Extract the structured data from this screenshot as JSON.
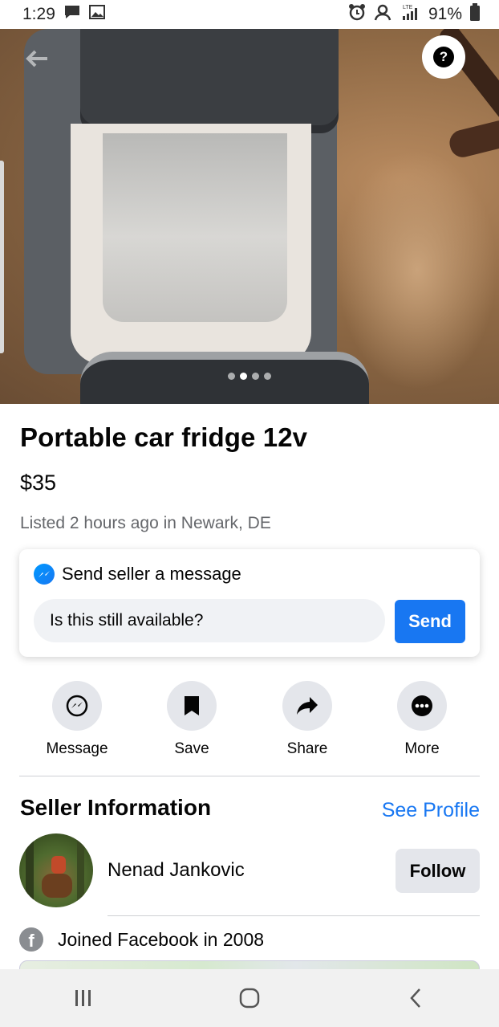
{
  "status_bar": {
    "time": "1:29",
    "battery": "91%",
    "icons": [
      "message-icon",
      "image-icon",
      "alarm-icon",
      "account-icon",
      "lte-signal-icon",
      "battery-icon"
    ]
  },
  "hero": {
    "image": "portable-car-fridge-photo",
    "slide_count": 4,
    "active_slide": 2
  },
  "listing": {
    "title": "Portable car fridge 12v",
    "price": "$35",
    "listed": "Listed 2 hours ago in Newark, DE"
  },
  "message_card": {
    "heading": "Send seller a message",
    "input_value": "Is this still available?",
    "send_label": "Send"
  },
  "actions": [
    {
      "label": "Message",
      "icon": "messenger-icon"
    },
    {
      "label": "Save",
      "icon": "bookmark-icon"
    },
    {
      "label": "Share",
      "icon": "share-icon"
    },
    {
      "label": "More",
      "icon": "more-icon"
    }
  ],
  "seller": {
    "heading": "Seller Information",
    "see_profile": "See Profile",
    "name": "Nenad Jankovic",
    "follow_label": "Follow",
    "joined": "Joined Facebook in 2008"
  },
  "nav": [
    "recents-icon",
    "home-icon",
    "back-icon"
  ],
  "colors": {
    "accent": "#1877f2",
    "secondary_text": "#65676b",
    "button_bg": "#e4e6eb"
  }
}
